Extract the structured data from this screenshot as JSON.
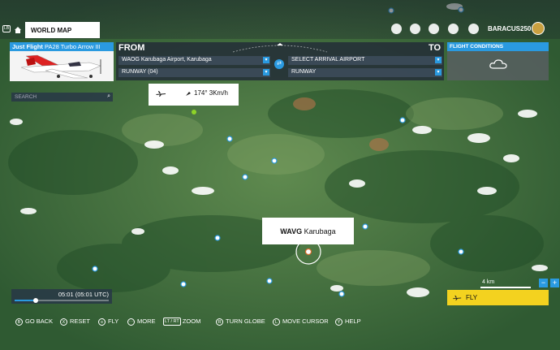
{
  "topbar": {
    "world_map_label": "WORLD MAP",
    "username": "BARACUS250"
  },
  "aircraft": {
    "brand": "Just Flight",
    "model": "PA28 Turbo Arrow III"
  },
  "route": {
    "from_label": "FROM",
    "to_label": "TO",
    "departure_airport": "WAOG Karubaga Airport, Karubaga",
    "departure_runway": "RUNWAY (04)",
    "arrival_placeholder": "SELECT ARRIVAL AIRPORT",
    "arrival_runway": "RUNWAY"
  },
  "conditions": {
    "label": "FLIGHT CONDITIONS"
  },
  "weather": {
    "wind": "174° 3Km/h"
  },
  "search": {
    "placeholder": "SEARCH"
  },
  "map_label": {
    "icao": "WAVG",
    "name": "Karubaga"
  },
  "time": {
    "display": "05:01 (05:01 UTC)",
    "progress": 0.22
  },
  "map_controls": {
    "scale": "4 km",
    "zoom_out": "−",
    "zoom_in": "+"
  },
  "fly_button": {
    "label": "FLY"
  },
  "hints": [
    {
      "key": "B",
      "label": "GO BACK"
    },
    {
      "key": "X",
      "label": "RESET"
    },
    {
      "key": "≡",
      "label": "FLY"
    },
    {
      "key": "⋯",
      "label": "MORE"
    },
    {
      "key": "LT / RT",
      "label": "ZOOM"
    },
    {
      "key": "R",
      "label": "TURN GLOBE"
    },
    {
      "key": "L",
      "label": "MOVE CURSOR"
    },
    {
      "key": "Y",
      "label": "HELP"
    }
  ],
  "colors": {
    "accent_blue": "#2a9ae0",
    "fly_yellow": "#f3d21f",
    "terrain_green": "#3d6a3a"
  }
}
